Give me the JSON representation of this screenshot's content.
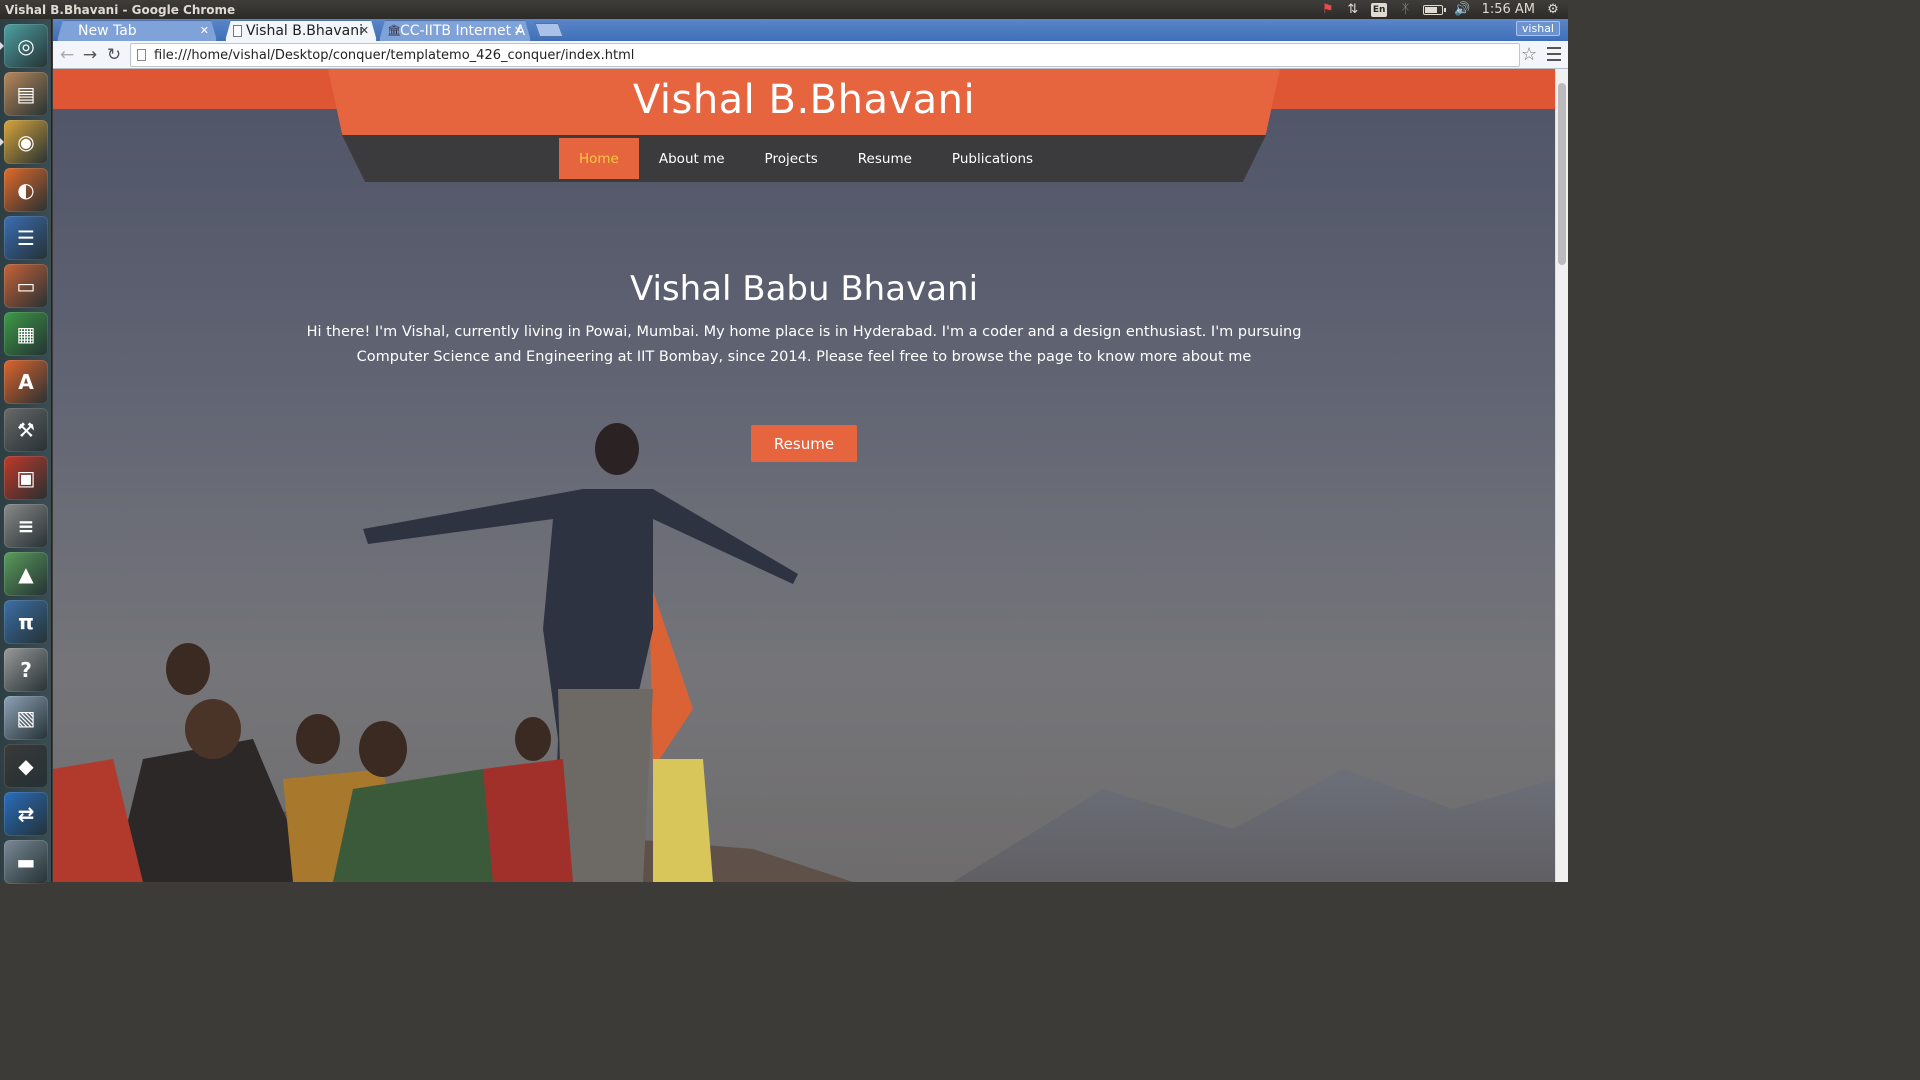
{
  "top_panel": {
    "window_title": "Vishal B.Bhavani - Google Chrome",
    "keyboard_layout": "En",
    "clock": "1:56 AM",
    "battery_level": 0.7
  },
  "launcher": {
    "items": [
      {
        "name": "dash-home",
        "icon": "ubuntu-logo-icon",
        "color": "#4fa3a5"
      },
      {
        "name": "files",
        "icon": "file-manager-icon",
        "color": "#b98a5c"
      },
      {
        "name": "chrome",
        "icon": "chrome-icon",
        "color": "#d9a63c"
      },
      {
        "name": "firefox",
        "icon": "firefox-icon",
        "color": "#e36b2b"
      },
      {
        "name": "writer",
        "icon": "libreoffice-writer-icon",
        "color": "#3c6fb4"
      },
      {
        "name": "impress",
        "icon": "libreoffice-impress-icon",
        "color": "#c8643a"
      },
      {
        "name": "calc",
        "icon": "libreoffice-calc-icon",
        "color": "#3f9c47"
      },
      {
        "name": "software-center",
        "icon": "software-center-icon",
        "color": "#e0662e"
      },
      {
        "name": "system-settings",
        "icon": "settings-icon",
        "color": "#6a6a6a"
      },
      {
        "name": "workspaces",
        "icon": "workspace-switcher-icon",
        "color": "#c23a2a"
      },
      {
        "name": "mixer",
        "icon": "sliders-icon",
        "color": "#8b8b8b"
      },
      {
        "name": "android-studio",
        "icon": "android-studio-icon",
        "color": "#5b9e5c"
      },
      {
        "name": "python",
        "icon": "python-icon",
        "color": "#3d71a8"
      },
      {
        "name": "help",
        "icon": "help-icon",
        "color": "#9a9a9a"
      },
      {
        "name": "image-viewer",
        "icon": "image-viewer-icon",
        "color": "#8fa3b8"
      },
      {
        "name": "inkscape",
        "icon": "inkscape-icon",
        "color": "#3b3b3b"
      },
      {
        "name": "teamviewer",
        "icon": "teamviewer-icon",
        "color": "#2a6fbf"
      },
      {
        "name": "disk",
        "icon": "disk-icon",
        "color": "#7a8a96"
      }
    ]
  },
  "browser": {
    "tabs": [
      {
        "title": "New Tab",
        "active": false
      },
      {
        "title": "Vishal B.Bhavani",
        "active": true
      },
      {
        "title": "CC-IITB Internet A",
        "active": false
      }
    ],
    "profile": "vishal",
    "url": "file:///home/vishal/Desktop/conquer/templatemo_426_conquer/index.html"
  },
  "site": {
    "title": "Vishal B.Bhavani",
    "nav": [
      "Home",
      "About me",
      "Projects",
      "Resume",
      "Publications"
    ],
    "active_nav": "Home",
    "hero": {
      "name": "Vishal Babu Bhavani",
      "bio": "Hi there! I'm Vishal, currently living in Powai, Mumbai. My home place is in Hyderabad. I'm a coder and a design enthusiast. I'm pursuing Computer Science and Engineering at IIT Bombay, since 2014. Please feel free to browse the page to know more about me",
      "button": "Resume"
    },
    "accent_color": "#e6643e",
    "nav_bg": "#3b3a3d"
  }
}
